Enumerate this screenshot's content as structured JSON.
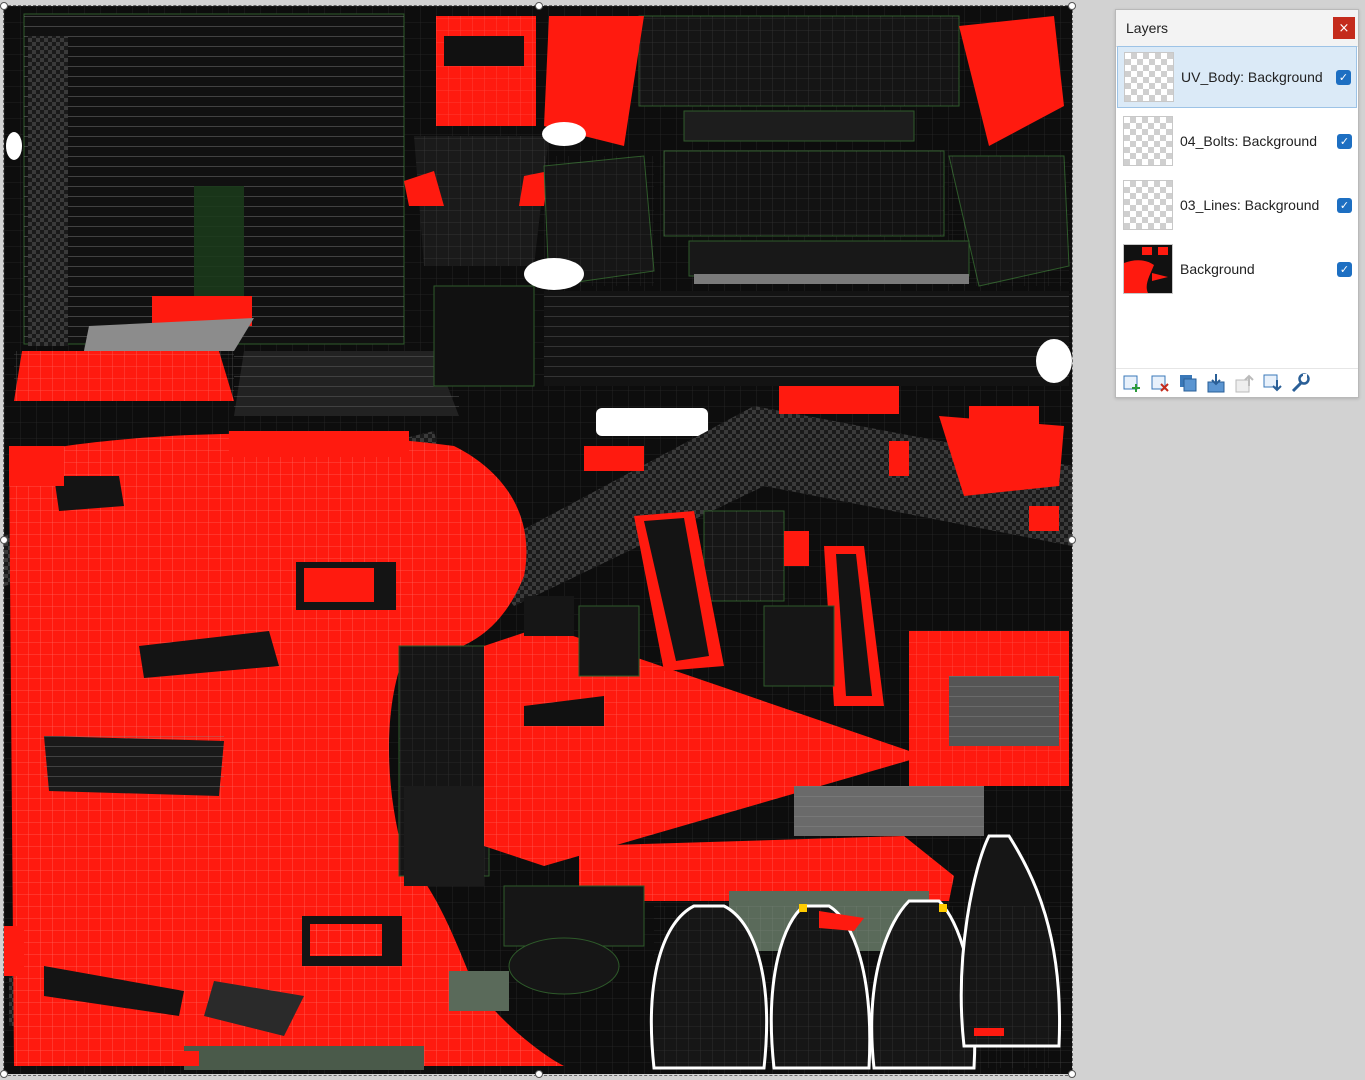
{
  "panel": {
    "title": "Layers",
    "close_label": "×"
  },
  "layers": [
    {
      "name": "UV_Body: Background",
      "visible": true,
      "selected": true
    },
    {
      "name": "04_Bolts: Background",
      "visible": true,
      "selected": false
    },
    {
      "name": "03_Lines: Background",
      "visible": true,
      "selected": false
    },
    {
      "name": "Background",
      "visible": true,
      "selected": false
    }
  ],
  "toolbar": {
    "icons": [
      "add-layer-icon",
      "delete-layer-icon",
      "duplicate-layer-icon",
      "merge-layer-down-icon",
      "move-layer-up-icon",
      "move-layer-down-icon",
      "layer-properties-icon"
    ]
  },
  "colors": {
    "uv_red": "#ff1a0f",
    "uv_dark": "#0d0d0d",
    "uv_wire_green": "#2e5a2a",
    "uv_wire_white": "#ffffff",
    "accent_blue": "#1d6fc2",
    "close_red": "#c42b1c"
  }
}
